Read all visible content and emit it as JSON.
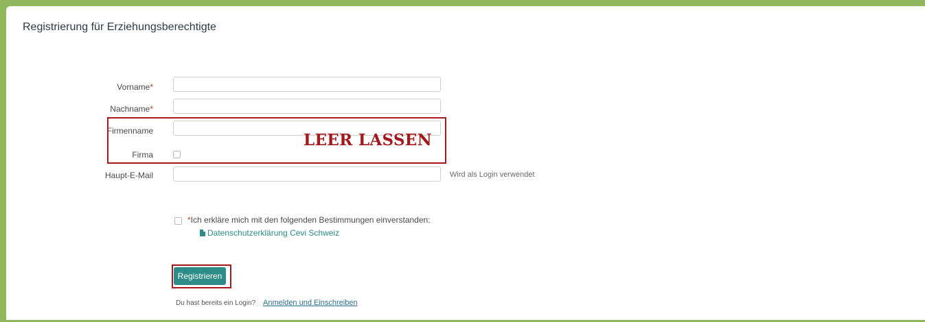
{
  "page": {
    "title": "Registrierung für Erziehungsberechtigte"
  },
  "form": {
    "required_mark": "*",
    "vorname": {
      "label": "Vorname",
      "value": ""
    },
    "nachname": {
      "label": "Nachname",
      "value": ""
    },
    "firmenname": {
      "label": "Firmenname",
      "value": ""
    },
    "firma": {
      "label": "Firma",
      "checked": false
    },
    "email": {
      "label": "Haupt-E-Mail",
      "value": "",
      "hint": "Wird als Login verwendet"
    },
    "terms": {
      "text": "Ich erkläre mich mit den folgenden Bestimmungen einverstanden:",
      "checked": false
    },
    "privacy_link": "Datenschutzerklärung Cevi Schweiz",
    "submit_label": "Registrieren"
  },
  "annotation": {
    "text": "LEER LASSEN",
    "color": "#a3191c"
  },
  "login": {
    "question": "Du hast bereits ein Login?",
    "link": "Anmelden und Einschreiben"
  },
  "colors": {
    "frame": "#8fb85c",
    "accent": "#2e8c88"
  }
}
